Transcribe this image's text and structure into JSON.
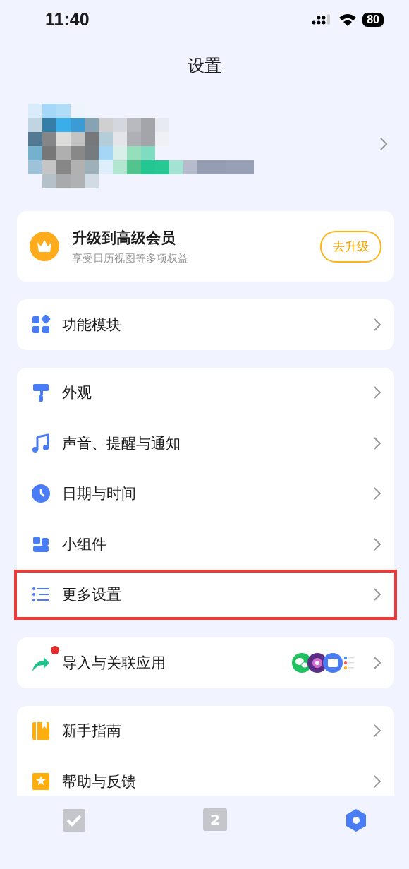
{
  "status_bar": {
    "time": "11:40",
    "battery": "80"
  },
  "title": "设置",
  "premium": {
    "title": "升级到高级会员",
    "subtitle": "享受日历视图等多项权益",
    "button": "去升级"
  },
  "groups": [
    {
      "items": [
        {
          "kind": "modules",
          "label": "功能模块",
          "highlighted": false
        }
      ]
    },
    {
      "items": [
        {
          "kind": "brush",
          "label": "外观",
          "highlighted": false
        },
        {
          "kind": "music",
          "label": "声音、提醒与通知",
          "highlighted": false
        },
        {
          "kind": "clock",
          "label": "日期与时间",
          "highlighted": false
        },
        {
          "kind": "widget",
          "label": "小组件",
          "highlighted": false
        },
        {
          "kind": "list",
          "label": "更多设置",
          "highlighted": true
        }
      ]
    },
    {
      "items": [
        {
          "kind": "share",
          "label": "导入与关联应用",
          "highlighted": false,
          "badge": true,
          "apps": true
        }
      ]
    },
    {
      "items": [
        {
          "kind": "book",
          "label": "新手指南",
          "highlighted": false
        },
        {
          "kind": "star",
          "label": "帮助与反馈",
          "highlighted": false
        }
      ]
    }
  ],
  "tabs": [
    {
      "kind": "check",
      "selected": false
    },
    {
      "kind": "calendar",
      "text": "2",
      "selected": false
    },
    {
      "kind": "settings",
      "selected": true
    }
  ]
}
